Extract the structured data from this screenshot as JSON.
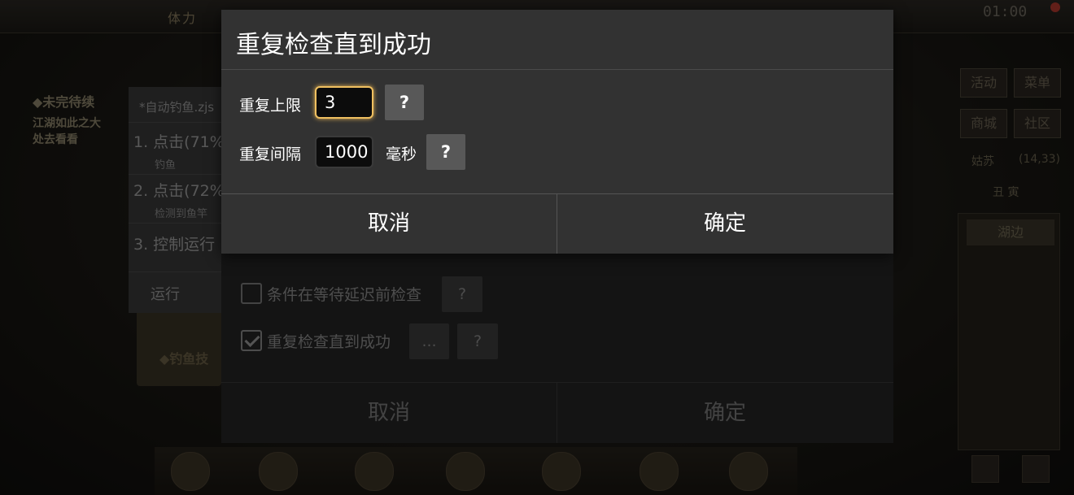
{
  "game": {
    "topbar_label": "体力",
    "clock": "01:00",
    "quest": {
      "title": "◆未完待续",
      "lines": [
        "江湖如此之大",
        "处去看看"
      ]
    },
    "right_buttons": [
      "活动",
      "菜单",
      "商城",
      "社区"
    ],
    "location": "姑苏",
    "coords": "(14,33)",
    "time_label": "丑 寅",
    "area_button": "湖边",
    "scroll_text": "◆钓鱼技"
  },
  "editor": {
    "filename": "*自动钓鱼.zjs",
    "steps": [
      {
        "label": "1. 点击(71%,",
        "sub": "钓鱼"
      },
      {
        "label": "2. 点击(72%",
        "sub": "检测到鱼竿"
      },
      {
        "label": "3. 控制运行",
        "sub": ""
      }
    ],
    "run_label": "运行"
  },
  "rear_dialog": {
    "options": [
      {
        "label": "条件在等待延迟前检查",
        "checked": false,
        "help": "?"
      },
      {
        "label": "重复检查直到成功",
        "checked": true,
        "more": "...",
        "help": "?"
      }
    ],
    "cancel_label": "取消",
    "confirm_label": "确定"
  },
  "front_dialog": {
    "title": "重复检查直到成功",
    "repeat_limit": {
      "label": "重复上限",
      "value": "3",
      "help": "?"
    },
    "repeat_interval": {
      "label": "重复间隔",
      "value": "1000",
      "unit": "毫秒",
      "help": "?"
    },
    "cancel_label": "取消",
    "confirm_label": "确定"
  },
  "colors": {
    "dialog_bg": "#323232",
    "focus_accent": "#f0c060",
    "help_button": "#585858"
  }
}
